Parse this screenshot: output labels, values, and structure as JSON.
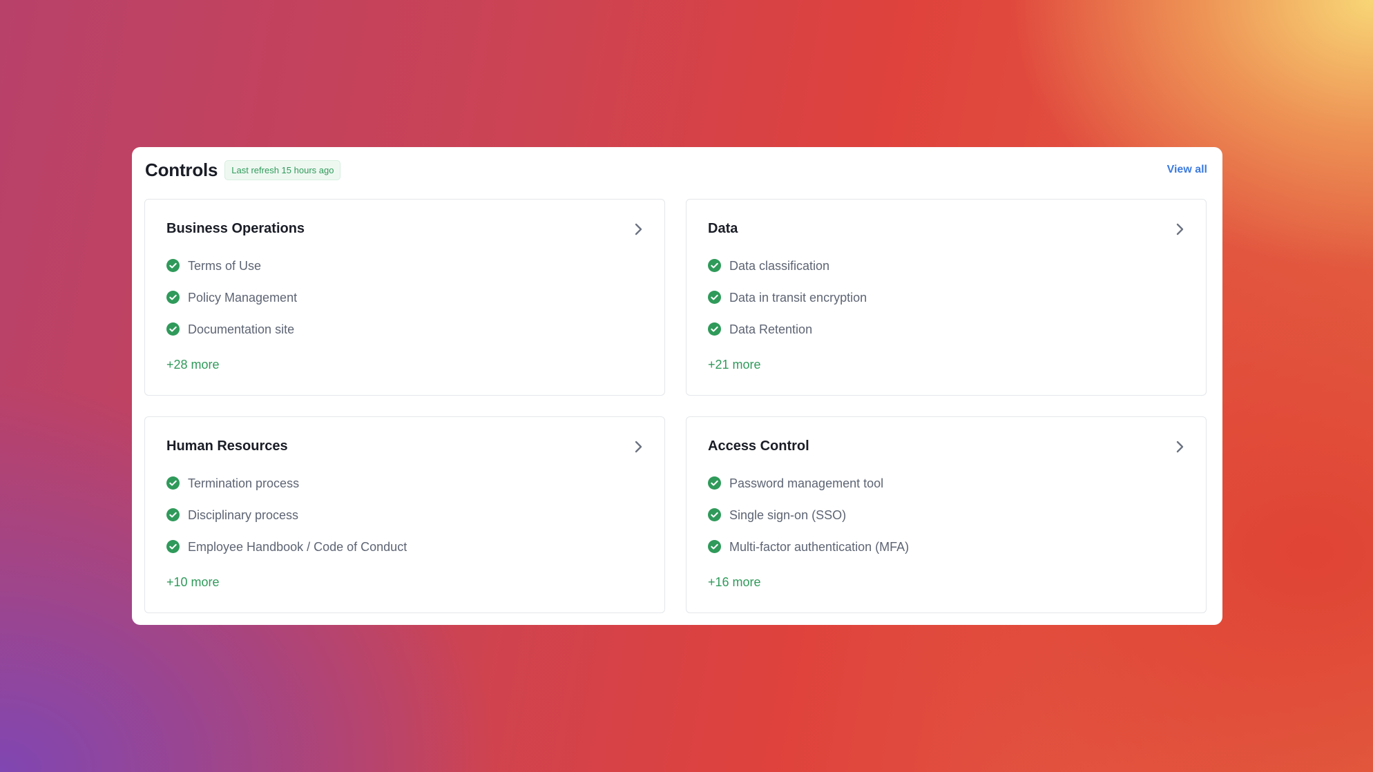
{
  "header": {
    "title": "Controls",
    "refresh_badge": "Last refresh 15 hours ago",
    "view_all": "View all"
  },
  "cards": [
    {
      "title": "Business Operations",
      "items": [
        "Terms of Use",
        "Policy Management",
        "Documentation site"
      ],
      "more": "+28 more"
    },
    {
      "title": "Data",
      "items": [
        "Data classification",
        "Data in transit encryption",
        "Data Retention"
      ],
      "more": "+21 more"
    },
    {
      "title": "Human Resources",
      "items": [
        "Termination process",
        "Disciplinary process",
        "Employee Handbook / Code of Conduct"
      ],
      "more": "+10 more"
    },
    {
      "title": "Access Control",
      "items": [
        "Password management tool",
        "Single sign-on (SSO)",
        "Multi-factor authentication (MFA)"
      ],
      "more": "+16 more"
    }
  ],
  "icons": {
    "check": "check-circle-icon",
    "chevron": "chevron-right-icon"
  },
  "colors": {
    "accent_green": "#2f9a5a",
    "link_blue": "#3c7be0",
    "title_text": "#1a1d26",
    "item_text": "#5d6473"
  }
}
